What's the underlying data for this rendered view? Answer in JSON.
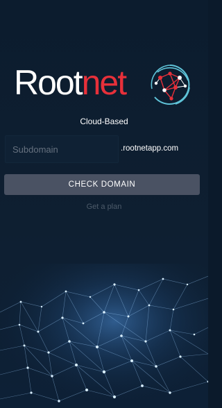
{
  "logo": {
    "word_part1": "Root",
    "word_part2": "net",
    "icon": "network-globe-icon"
  },
  "tagline": "Cloud-Based",
  "subdomain_field": {
    "value": "",
    "placeholder": "Subdomain"
  },
  "domain_suffix": ".rootnetapp.com",
  "check_button_label": "CHECK DOMAIN",
  "plan_link_label": "Get a plan",
  "background_icon": "network-mesh-icon",
  "colors": {
    "background": "#0c1c2e",
    "brand_red": "#e7303a",
    "button": "#4a5263",
    "link": "#4d5b6a",
    "placeholder": "#66717f",
    "network_glow": "#6fb6ff"
  }
}
